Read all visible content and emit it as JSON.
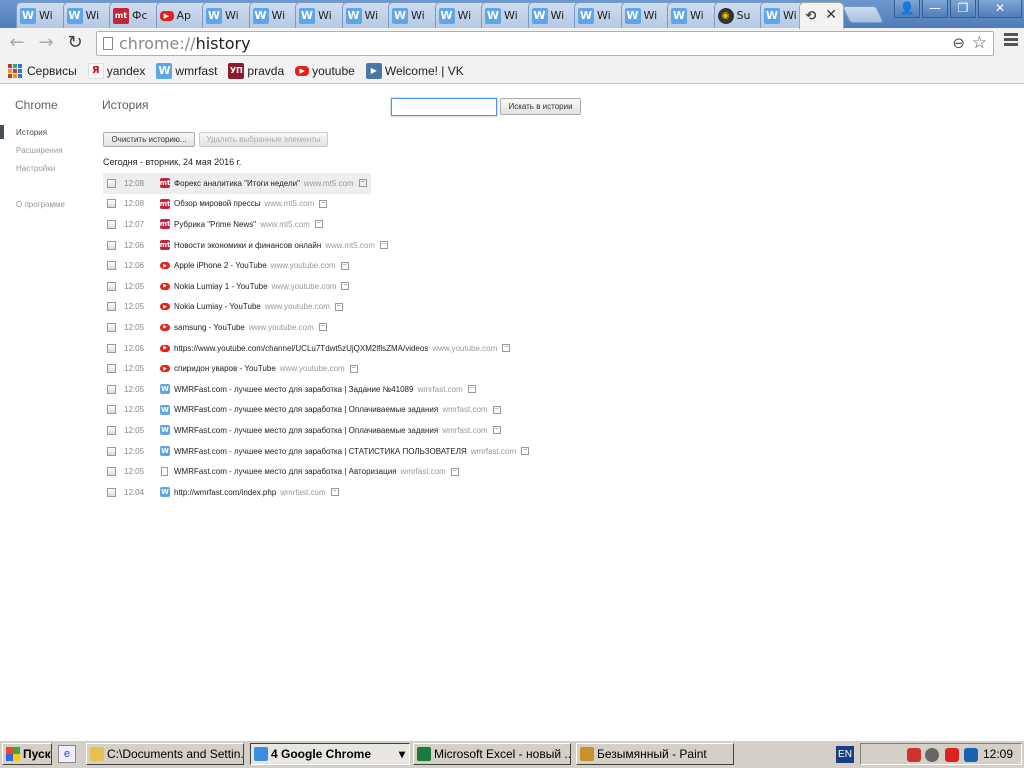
{
  "tabs": [
    {
      "label": "Wi",
      "icon": "W",
      "kind": "w"
    },
    {
      "label": "Wi",
      "icon": "W",
      "kind": "w"
    },
    {
      "label": "Фс",
      "icon": "mt",
      "kind": "mt"
    },
    {
      "label": "Ap",
      "icon": "▶",
      "kind": "yt"
    },
    {
      "label": "Wi",
      "icon": "W",
      "kind": "w"
    },
    {
      "label": "Wi",
      "icon": "W",
      "kind": "w"
    },
    {
      "label": "Wi",
      "icon": "W",
      "kind": "w"
    },
    {
      "label": "Wi",
      "icon": "W",
      "kind": "w"
    },
    {
      "label": "Wi",
      "icon": "W",
      "kind": "w"
    },
    {
      "label": "Wi",
      "icon": "W",
      "kind": "w"
    },
    {
      "label": "Wi",
      "icon": "W",
      "kind": "w"
    },
    {
      "label": "Wi",
      "icon": "W",
      "kind": "w"
    },
    {
      "label": "Wi",
      "icon": "W",
      "kind": "w"
    },
    {
      "label": "Wi",
      "icon": "W",
      "kind": "w"
    },
    {
      "label": "Wi",
      "icon": "W",
      "kind": "w"
    },
    {
      "label": "Su",
      "icon": "◉",
      "kind": "su"
    },
    {
      "label": "Wi",
      "icon": "W",
      "kind": "w"
    }
  ],
  "active_tab": {
    "icon": "⟲",
    "close": "✕"
  },
  "window_buttons": {
    "user": "👤",
    "minimize": "—",
    "restore": "❐",
    "close": "✕"
  },
  "toolbar": {
    "back": "←",
    "forward": "→",
    "reload": "↻",
    "url_scheme": "chrome://",
    "url_path": "history",
    "zoom_icon": "⊖",
    "star_icon": "☆"
  },
  "bookmarks": [
    {
      "label": "Сервисы",
      "kind": "apps",
      "icon": ""
    },
    {
      "label": "yandex",
      "kind": "ya",
      "icon": "Я"
    },
    {
      "label": "wmrfast",
      "kind": "w",
      "icon": "W"
    },
    {
      "label": "pravda",
      "kind": "up",
      "icon": "УП"
    },
    {
      "label": "youtube",
      "kind": "yt",
      "icon": "▶"
    },
    {
      "label": "Welcome! | VK",
      "kind": "vk",
      "icon": "▶"
    }
  ],
  "page": {
    "brand": "Chrome",
    "nav": [
      "История",
      "Расширения",
      "Настройки"
    ],
    "nav_about": "О программе",
    "title": "История",
    "search_value": "",
    "search_button": "Искать в истории",
    "clear_button": "Очистить историю...",
    "remove_button": "Удалить выбранные элементы",
    "day_header": "Сегодня - вторник, 24 мая 2016 г.",
    "dropdown_glyph": "−",
    "entries": [
      {
        "time": "12:08",
        "title": "Форекс аналитика \"Итоги недели\"",
        "domain": "www.mt5.com",
        "kind": "mt",
        "icon": "mt"
      },
      {
        "time": "12:08",
        "title": "Обзор мировой прессы",
        "domain": "www.mt5.com",
        "kind": "mt",
        "icon": "mt"
      },
      {
        "time": "12:07",
        "title": "Рубрика \"Prime News\"",
        "domain": "www.mt5.com",
        "kind": "mt",
        "icon": "mt"
      },
      {
        "time": "12:06",
        "title": "Новости экономики и финансов онлайн",
        "domain": "www.mt5.com",
        "kind": "mt",
        "icon": "mt"
      },
      {
        "time": "12:06",
        "title": "Apple iPhone 2 - YouTube",
        "domain": "www.youtube.com",
        "kind": "yt",
        "icon": "▶"
      },
      {
        "time": "12:05",
        "title": "Nokia Lumiay 1 - YouTube",
        "domain": "www.youtube.com",
        "kind": "yt",
        "icon": "▶"
      },
      {
        "time": "12:05",
        "title": "Nokia Lumiay - YouTube",
        "domain": "www.youtube.com",
        "kind": "yt",
        "icon": "▶"
      },
      {
        "time": "12:05",
        "title": "samsung - YouTube",
        "domain": "www.youtube.com",
        "kind": "yt",
        "icon": "▶"
      },
      {
        "time": "12:05",
        "title": "https://www.youtube.com/channel/UCLu7Tdwt5zUjQXM2lflsZMA/videos",
        "domain": "www.youtube.com",
        "kind": "yt",
        "icon": "▶"
      },
      {
        "time": "12:05",
        "title": "спиридон уваров - YouTube",
        "domain": "www.youtube.com",
        "kind": "yt",
        "icon": "▶"
      },
      {
        "time": "12:05",
        "title": "WMRFast.com - лучшее место для заработка | Задание №41089",
        "domain": "wmrfast.com",
        "kind": "w",
        "icon": "W"
      },
      {
        "time": "12:05",
        "title": "WMRFast.com - лучшее место для заработка | Оплачиваемые задания",
        "domain": "wmrfast.com",
        "kind": "w",
        "icon": "W"
      },
      {
        "time": "12:05",
        "title": "WMRFast.com - лучшее место для заработка | Оплачиваемые задания",
        "domain": "wmrfast.com",
        "kind": "w",
        "icon": "W"
      },
      {
        "time": "12:05",
        "title": "WMRFast.com - лучшее место для заработка | СТАТИСТИКА ПОЛЬЗОВАТЕЛЯ",
        "domain": "wmrfast.com",
        "kind": "w",
        "icon": "W"
      },
      {
        "time": "12:05",
        "title": "WMRFast.com - лучшее место для заработка | Авторизация",
        "domain": "wmrfast.com",
        "kind": "doc",
        "icon": ""
      },
      {
        "time": "12:04",
        "title": "http://wmrfast.com/index.php",
        "domain": "wmrfast.com",
        "kind": "w",
        "icon": "W"
      }
    ]
  },
  "taskbar": {
    "start": "Пуск",
    "quicklaunch_icon": "e",
    "tasks": [
      {
        "label": "C:\\Documents and Settin...",
        "color": "#e8c050"
      },
      {
        "label": "4 Google Chrome",
        "color": "#3a8de0",
        "active": true,
        "arrow": "▾"
      },
      {
        "label": "Microsoft Excel - новый ...",
        "color": "#1d7a3a"
      },
      {
        "label": "Безымянный - Paint",
        "color": "#c8902a"
      }
    ],
    "lang": "EN",
    "clock": "12:09"
  }
}
